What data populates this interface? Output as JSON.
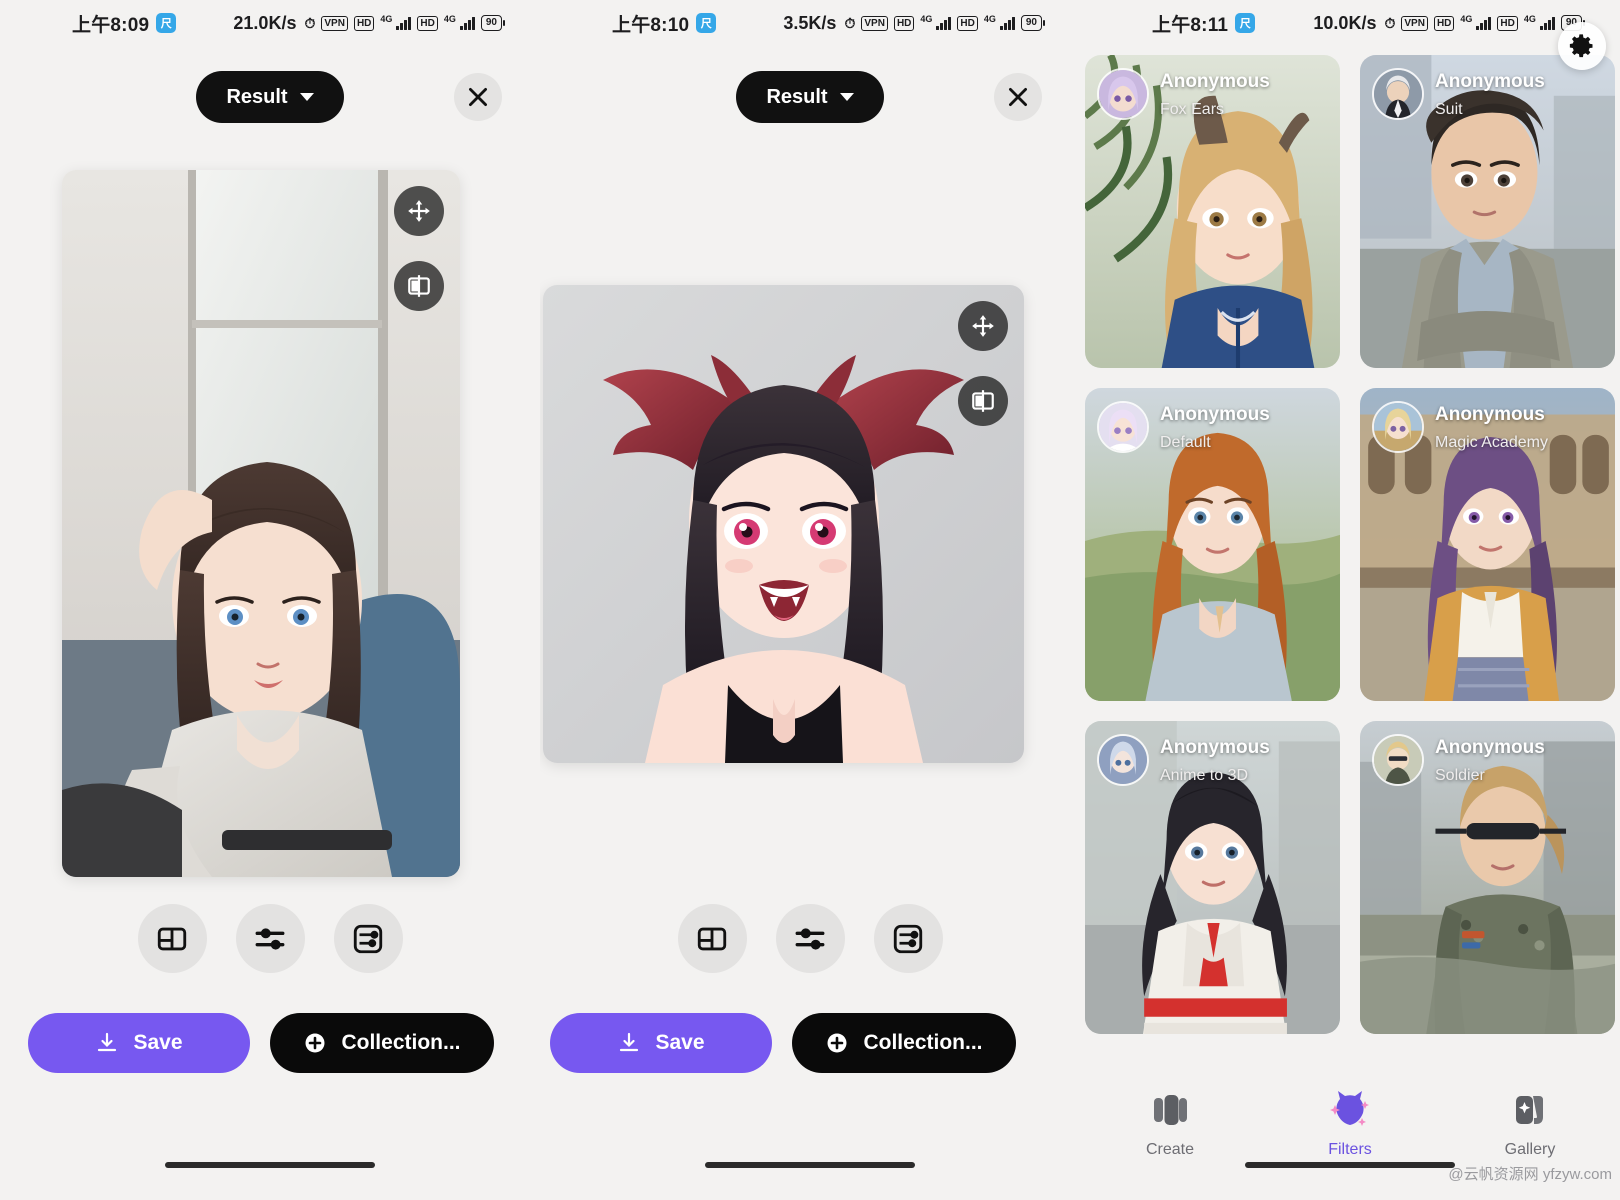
{
  "app": {
    "accent_purple": "#7758f0",
    "black": "#0a0a0a",
    "bg": "#f3f2f1"
  },
  "screens": [
    {
      "id": "result-1",
      "statusbar": {
        "time": "上午8:09",
        "app_badge": "尺",
        "net_speed": "21.0K/s",
        "alarm_icon": "alarm-icon",
        "vpn": "VPN",
        "hd1": "HD",
        "g4_1": "4G",
        "hd2": "HD",
        "g4_2": "4G",
        "battery": "90"
      },
      "header": {
        "title": "Result",
        "dropdown_icon": "chevron-down-icon",
        "close_icon": "close-icon"
      },
      "preview": {
        "move_icon": "move-arrows-icon",
        "compare_icon": "compare-split-icon",
        "alt": "anime girl in grey hoodie sitting by window"
      },
      "tools": [
        {
          "name": "layout-icon",
          "label": "Layout"
        },
        {
          "name": "sliders-icon",
          "label": "Adjust"
        },
        {
          "name": "parameters-icon",
          "label": "Parameters"
        }
      ],
      "actions": {
        "save_label": "Save",
        "save_icon": "download-icon",
        "collection_label": "Collection...",
        "collection_icon": "plus-circle-icon"
      }
    },
    {
      "id": "result-2",
      "statusbar": {
        "time": "上午8:10",
        "app_badge": "尺",
        "net_speed": "3.5K/s",
        "alarm_icon": "alarm-icon",
        "vpn": "VPN",
        "hd1": "HD",
        "g4_1": "4G",
        "hd2": "HD",
        "g4_2": "4G",
        "battery": "90"
      },
      "header": {
        "title": "Result",
        "dropdown_icon": "chevron-down-icon",
        "close_icon": "close-icon"
      },
      "preview": {
        "move_icon": "move-arrows-icon",
        "compare_icon": "compare-split-icon",
        "alt": "anime succubus girl with dark wings"
      },
      "tools": [
        {
          "name": "layout-icon",
          "label": "Layout"
        },
        {
          "name": "sliders-icon",
          "label": "Adjust"
        },
        {
          "name": "parameters-icon",
          "label": "Parameters"
        }
      ],
      "actions": {
        "save_label": "Save",
        "save_icon": "download-icon",
        "collection_label": "Collection...",
        "collection_icon": "plus-circle-icon"
      }
    },
    {
      "id": "filters-gallery",
      "statusbar": {
        "time": "上午8:11",
        "app_badge": "尺",
        "net_speed": "10.0K/s",
        "alarm_icon": "alarm-icon",
        "vpn": "VPN",
        "hd1": "HD",
        "g4_1": "4G",
        "hd2": "HD",
        "g4_2": "4G",
        "battery": "90"
      },
      "settings_icon": "gear-icon",
      "gallery": [
        {
          "author": "Anonymous",
          "filter": "Fox Ears"
        },
        {
          "author": "Anonymous",
          "filter": "Suit"
        },
        {
          "author": "Anonymous",
          "filter": "Default"
        },
        {
          "author": "Anonymous",
          "filter": "Magic Academy"
        },
        {
          "author": "Anonymous",
          "filter": "Anime to 3D"
        },
        {
          "author": "Anonymous",
          "filter": "Soldier"
        }
      ],
      "tabs": [
        {
          "label": "Create",
          "icon": "cards-icon",
          "active": false
        },
        {
          "label": "Filters",
          "icon": "cat-sparkle-icon",
          "active": true
        },
        {
          "label": "Gallery",
          "icon": "gallery-sparkle-icon",
          "active": false
        }
      ],
      "watermark": "@云帆资源网 yfzyw.com"
    }
  ]
}
